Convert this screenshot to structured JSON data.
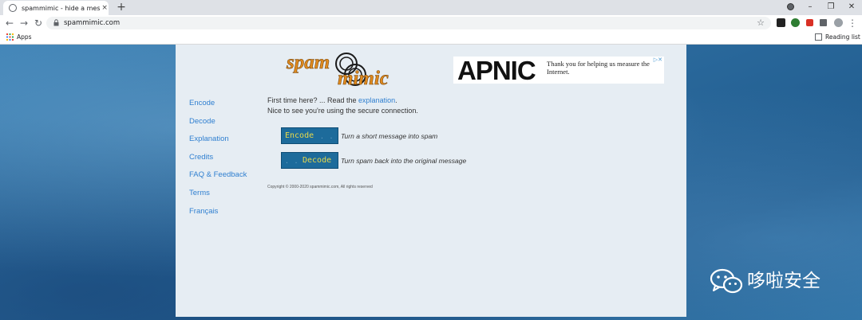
{
  "browser": {
    "tab_title": "spammimic - hide a message in spam",
    "tab_close": "×",
    "new_tab": "+",
    "url": "spammimic.com",
    "bookmarks": {
      "apps": "Apps",
      "reading_list": "Reading list"
    },
    "window_controls": {
      "minimize": "–",
      "restore": "❐",
      "close": "✕"
    },
    "menu": "⋮",
    "star": "☆",
    "back": "←",
    "forward": "→",
    "reload": "↻"
  },
  "logo": {
    "line1": "spam",
    "line2": "mimic"
  },
  "ad": {
    "brand": "APNIC",
    "text": "Thank you for helping us measure the Internet.",
    "badge": "▷✕"
  },
  "nav": {
    "items": [
      {
        "label": "Encode"
      },
      {
        "label": "Decode"
      },
      {
        "label": "Explanation"
      },
      {
        "label": "Credits"
      },
      {
        "label": "FAQ & Feedback"
      },
      {
        "label": "Terms"
      },
      {
        "label": "Français"
      }
    ]
  },
  "intro": {
    "line1_prefix": "First time here? ... Read the ",
    "line1_link": "explanation",
    "line1_suffix": ".",
    "line2": "Nice to see you're using the secure connection."
  },
  "actions": {
    "encode": {
      "label": "Encode",
      "desc": "Turn a short message into spam"
    },
    "decode": {
      "label": "Decode",
      "desc": "Turn spam back into the original message"
    }
  },
  "copyright": "Copyright © 2000-2020 spammimic.com, All rights reserved",
  "watermark": {
    "text": "哆啦安全"
  },
  "colors": {
    "panel": "#e6edf3",
    "link": "#2f7fd0",
    "button": "#1d6b9b",
    "button_text": "#e8d94a",
    "logo": "#e08a1e"
  }
}
